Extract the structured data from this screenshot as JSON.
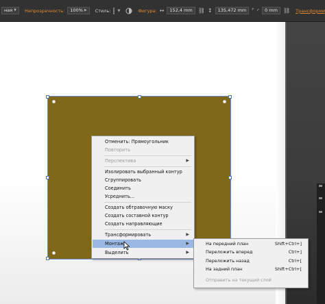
{
  "controlbar": {
    "dropdown_partial": "ная",
    "opacity_label": "Непрозрачность:",
    "opacity_value": "100%",
    "styles_label": "Стиль:",
    "shape_label": "Фигура:",
    "width_value": "152,4 mm",
    "height_value": "135,472 mm",
    "corner_value": "0 mm",
    "transform_link": "Трансформирование"
  },
  "context_menu": {
    "items": [
      {
        "label": "Отменить: Прямоугольник",
        "enabled": true
      },
      {
        "label": "Повторить",
        "enabled": false
      },
      {
        "label": "Перспектива",
        "enabled": false,
        "submenu": true
      },
      {
        "label": "Изолировать выбранный контур",
        "enabled": true
      },
      {
        "label": "Сгруппировать",
        "enabled": true
      },
      {
        "label": "Соединить",
        "enabled": true
      },
      {
        "label": "Усреднить...",
        "enabled": true
      },
      {
        "label": "Создать обтравочную маску",
        "enabled": true
      },
      {
        "label": "Создать составной контур",
        "enabled": true
      },
      {
        "label": "Создать направляющие",
        "enabled": true
      },
      {
        "label": "Трансформировать",
        "enabled": true,
        "submenu": true
      },
      {
        "label": "Монтаж",
        "enabled": true,
        "submenu": true,
        "highlighted": true
      },
      {
        "label": "Выделить",
        "enabled": true,
        "submenu": true
      }
    ]
  },
  "arrange_submenu": {
    "items": [
      {
        "label": "На передний план",
        "shortcut": "Shift+Ctrl+]",
        "enabled": true
      },
      {
        "label": "Переложить вперед",
        "shortcut": "Ctrl+]",
        "enabled": true
      },
      {
        "label": "Переложить назад",
        "shortcut": "Ctrl+[",
        "enabled": true
      },
      {
        "label": "На задний план",
        "shortcut": "Shift+Ctrl+[",
        "enabled": true
      },
      {
        "label": "Отправить на текущий слой",
        "shortcut": "",
        "enabled": false
      }
    ]
  },
  "colors": {
    "shape_fill": "#80681a",
    "selection": "#4a6fd0",
    "menu_highlight": "#9ab8e3",
    "accent_orange": "#e08a2e"
  },
  "icons": {
    "submenu_arrow": "chevron-right-icon",
    "cursor": "mouse-pointer-icon"
  }
}
